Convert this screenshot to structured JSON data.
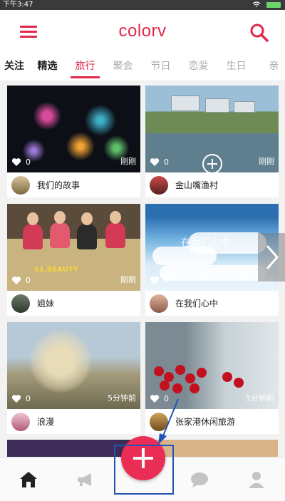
{
  "status_bar": {
    "time": "下午3:47"
  },
  "header": {
    "logo": "colorv"
  },
  "tabs": [
    "关注",
    "精选",
    "旅行",
    "聚会",
    "节日",
    "恋爱",
    "生日",
    "亲"
  ],
  "cards": [
    {
      "title": "我们的故事",
      "likes": "0",
      "time": "刚刚",
      "thumb": "fireworks"
    },
    {
      "title": "金山嘴渔村",
      "likes": "0",
      "time": "刚刚",
      "thumb": "village"
    },
    {
      "title": "姐妹",
      "likes": "0",
      "time": "刚刚",
      "thumb": "dinner",
      "tag": "01.BEAUTY"
    },
    {
      "title": "在我们心中",
      "likes": "0",
      "time": "刚刚",
      "thumb": "sky",
      "overlay": "在我们心中"
    },
    {
      "title": "浪漫",
      "likes": "0",
      "time": "5分钟前",
      "thumb": "dandelion"
    },
    {
      "title": "张家港休闲旅游",
      "likes": "0",
      "time": "5分钟前",
      "thumb": "cherries"
    }
  ],
  "colors": {
    "accent": "#e1274a",
    "annotation": "#2453b4"
  },
  "bottom_nav": [
    "home-icon",
    "megaphone-icon",
    "add-icon",
    "message-icon",
    "profile-icon"
  ]
}
